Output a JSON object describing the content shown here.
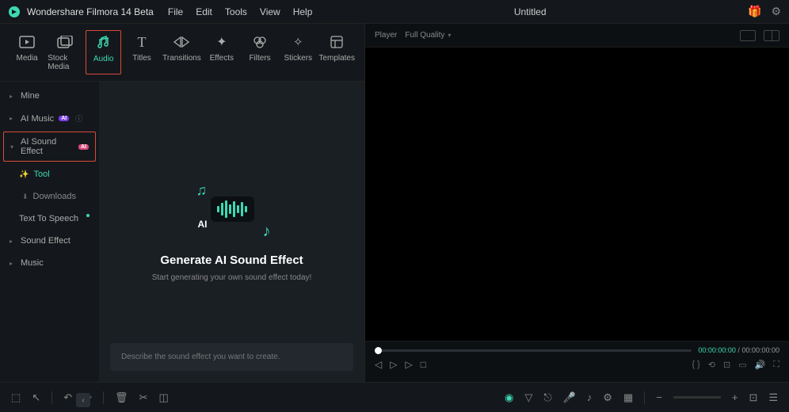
{
  "app_name": "Wondershare Filmora 14 Beta",
  "document_title": "Untitled",
  "menus": {
    "file": "File",
    "edit": "Edit",
    "tools": "Tools",
    "view": "View",
    "help": "Help"
  },
  "toolbar": {
    "media": "Media",
    "stock": "Stock Media",
    "audio": "Audio",
    "titles": "Titles",
    "transitions": "Transitions",
    "effects": "Effects",
    "filters": "Filters",
    "stickers": "Stickers",
    "templates": "Templates"
  },
  "sidebar": {
    "mine": "Mine",
    "ai_music": "AI Music",
    "ai_sound_effect": "AI Sound Effect",
    "tool": "Tool",
    "downloads": "Downloads",
    "tts": "Text To Speech",
    "sound_effect": "Sound Effect",
    "music": "Music",
    "ai_badge": "AI"
  },
  "main": {
    "title": "Generate AI Sound Effect",
    "subtitle": "Start generating your own sound effect today!",
    "prompt_placeholder": "Describe the sound effect you want to create."
  },
  "player": {
    "label": "Player",
    "quality": "Full Quality",
    "time_current": "00:00:00:00",
    "time_total": "00:00:00:00",
    "sep": "/"
  }
}
